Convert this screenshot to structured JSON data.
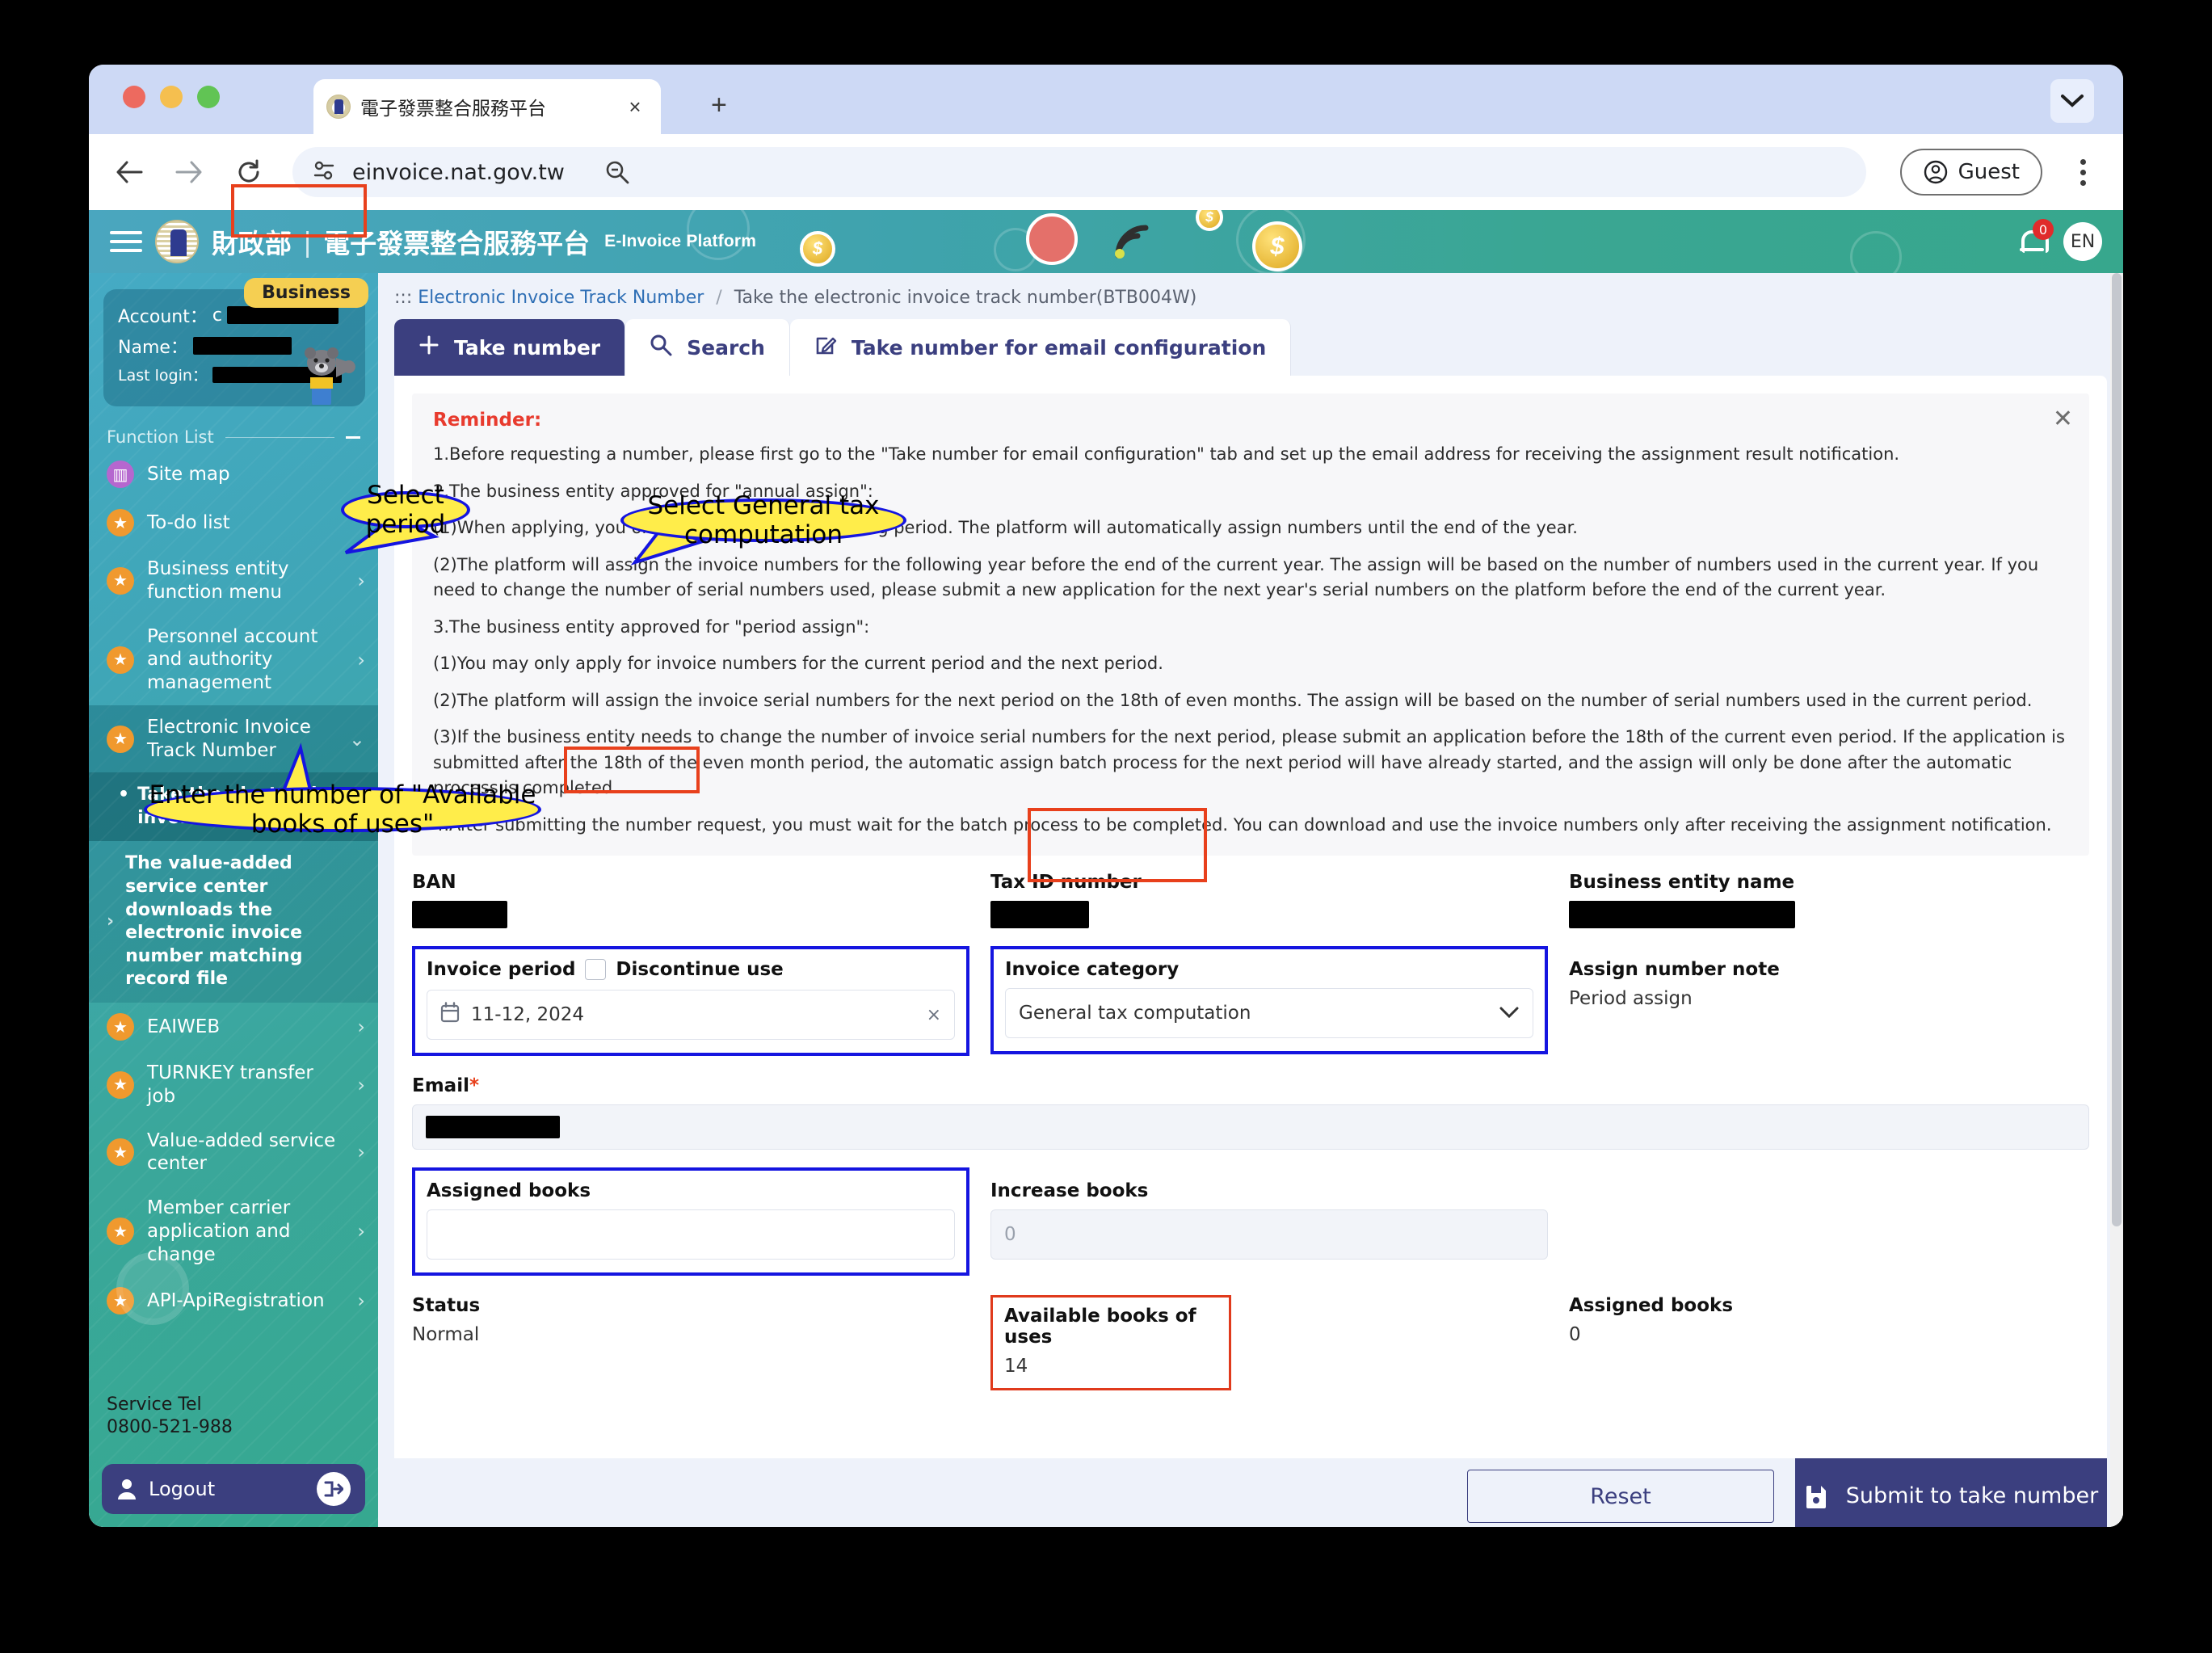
{
  "browser": {
    "tab_title": "電子發票整合服務平台",
    "url": "einvoice.nat.gov.tw",
    "profile_label": "Guest",
    "new_tab_glyph": "+",
    "tab_close_glyph": "×"
  },
  "site_header": {
    "org": "財政部",
    "divider": "|",
    "platform_zh": "電子發票整合服務平台",
    "platform_en": "E-Invoice Platform",
    "notification_count": "0",
    "language": "EN"
  },
  "sidebar": {
    "badge": "Business",
    "account_label": "Account：",
    "account_value_prefix": "c",
    "name_label": "Name：",
    "last_login_label": "Last login：",
    "function_list_title": "Function List",
    "items": [
      {
        "label": "Site map",
        "icon": "map-icon",
        "chevron": ""
      },
      {
        "label": "To-do list",
        "icon": "star-icon",
        "chevron": ""
      },
      {
        "label": "Business entity function menu",
        "icon": "star-icon",
        "chevron": "›"
      },
      {
        "label": "Personnel account and authority management",
        "icon": "star-icon",
        "chevron": "›"
      },
      {
        "label": "Electronic Invoice Track Number",
        "icon": "star-icon",
        "chevron": "⌄",
        "active": true
      }
    ],
    "sub_items": [
      {
        "label": "Take the electronic invoice track number",
        "current": true,
        "bullet": "•"
      },
      {
        "label": "The value-added service center downloads the electronic invoice number matching record file",
        "current": false,
        "chevron": "›"
      }
    ],
    "items_after": [
      {
        "label": "EAIWEB",
        "icon": "star-icon",
        "chevron": "›"
      },
      {
        "label": "TURNKEY transfer job",
        "icon": "star-icon",
        "chevron": "›"
      },
      {
        "label": "Value-added service center",
        "icon": "star-icon",
        "chevron": "›"
      },
      {
        "label": "Member carrier application and change",
        "icon": "star-icon",
        "chevron": "›"
      },
      {
        "label": "API-ApiRegistration",
        "icon": "star-icon",
        "chevron": "›"
      }
    ],
    "service_tel_label": "Service Tel",
    "service_tel_number": "0800-521-988",
    "logout_label": "Logout"
  },
  "breadcrumb": {
    "prefix": ":::",
    "root": "Electronic Invoice Track Number",
    "separator": "/",
    "current": "Take the electronic invoice track number(BTB004W)"
  },
  "tabs": [
    {
      "label": "Take number",
      "icon": "plus-icon",
      "active": true
    },
    {
      "label": "Search",
      "icon": "search-icon",
      "active": false
    },
    {
      "label": "Take number for email configuration",
      "icon": "edit-icon",
      "active": false
    }
  ],
  "reminder": {
    "title": "Reminder:",
    "close_glyph": "✕",
    "lines": [
      "1.Before requesting a number, please first go to the \"Take number for email configuration\" tab and set up the email address for receiving the assignment result notification.",
      "2.The business entity approved for \"annual assign\":",
      "(1)When applying, you only need to fill in the starting period. The platform will automatically assign numbers until the end of the year.",
      "(2)The platform will assign the invoice numbers for the following year before the end of the current year. The assign will be based on the number of numbers used in the current year. If you need to change the number of serial numbers used, please submit a new application for the next year's serial numbers on the platform before the end of the current year.",
      "3.The business entity approved for \"period assign\":",
      "(1)You may only apply for invoice numbers for the current period and the next period.",
      "(2)The platform will assign the invoice serial numbers for the next period on the 18th of even months. The assign will be based on the number of serial numbers used in the current period.",
      "(3)If the business entity needs to change the number of invoice serial numbers for the next period, please submit an application before the 18th of the current even period. If the application is submitted after the 18th of the even month period, the automatic assign batch process for the next period will have already started, and the assign will only be done after the automatic process is completed.",
      "4.After submitting the number request, you must wait for the batch process to be completed. You can download and use the invoice numbers only after receiving the assignment notification."
    ]
  },
  "form": {
    "ban_label": "BAN",
    "ban_value": "",
    "taxid_label": "Tax ID number",
    "taxid_value": "",
    "entity_label": "Business entity name",
    "entity_value": "",
    "invoice_period_label": "Invoice period",
    "discontinue_label": "Discontinue use",
    "invoice_period_value": "11-12, 2024",
    "invoice_period_clear": "×",
    "calendar_icon": "calendar-icon",
    "invoice_category_label": "Invoice category",
    "invoice_category_value": "General tax computation",
    "assign_note_label": "Assign number note",
    "assign_note_value": "Period assign",
    "email_label": "Email",
    "email_required": "*",
    "email_value": "",
    "assigned_books_input_label": "Assigned books",
    "assigned_books_input_value": "",
    "increase_books_label": "Increase books",
    "increase_books_placeholder": "0",
    "status_label": "Status",
    "status_value": "Normal",
    "available_books_label": "Available books of uses",
    "available_books_value": "14",
    "assigned_books_label": "Assigned books",
    "assigned_books_value": "0"
  },
  "footer": {
    "reset_label": "Reset",
    "submit_label": "Submit to take number",
    "submit_icon": "save-icon"
  },
  "annotations": [
    {
      "id": "select-period",
      "text": "Select period"
    },
    {
      "id": "select-general-tax",
      "text": "Select General tax computation"
    },
    {
      "id": "enter-available-books",
      "text": "Enter the number of \"Available books of uses\""
    }
  ],
  "colors": {
    "accent_navy": "#3b3f7f",
    "header_teal": "#3fa3ad",
    "reminder_red": "#e83b2e",
    "highlight_yellow": "#ffed4a",
    "callout_blue": "#1515e0",
    "annotation_red": "#e8401c"
  }
}
